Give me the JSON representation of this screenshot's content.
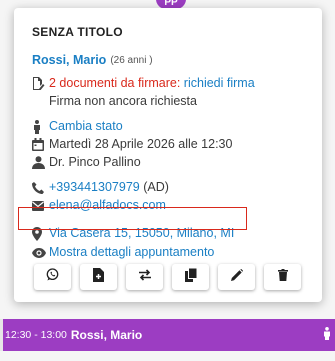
{
  "header_badge": "PP",
  "popup": {
    "title": "SENZA TITOLO",
    "patient_name": "Rossi, Mario",
    "patient_age": "(26 anni )",
    "documents_count": "2 documenti da firmare:",
    "documents_action": "richiedi firma",
    "signature_status": "Firma non ancora richiesta",
    "change_state": "Cambia stato",
    "appointment_date": "Martedì 28 Aprile 2026 alle 12:30",
    "doctor": "Dr. Pinco Pallino",
    "phone": "+393441307979",
    "phone_suffix": "(AD)",
    "email": "elena@alfadocs.com",
    "address": "Via Casera 15, 15050, Milano, MI",
    "show_details": "Mostra dettagli appuntamento"
  },
  "actions": [
    {
      "name": "whatsapp-button",
      "icon": "whatsapp-icon"
    },
    {
      "name": "add-document-button",
      "icon": "file-plus-icon"
    },
    {
      "name": "move-button",
      "icon": "swap-icon"
    },
    {
      "name": "copy-button",
      "icon": "copy-icon"
    },
    {
      "name": "edit-button",
      "icon": "pencil-icon"
    },
    {
      "name": "delete-button",
      "icon": "trash-icon"
    }
  ],
  "event": {
    "time": "12:30 - 13:00",
    "name": "Rossi, Mario"
  },
  "colors": {
    "accent": "#9c3dc2",
    "link": "#1a7fc4",
    "alert": "#d9291c"
  }
}
